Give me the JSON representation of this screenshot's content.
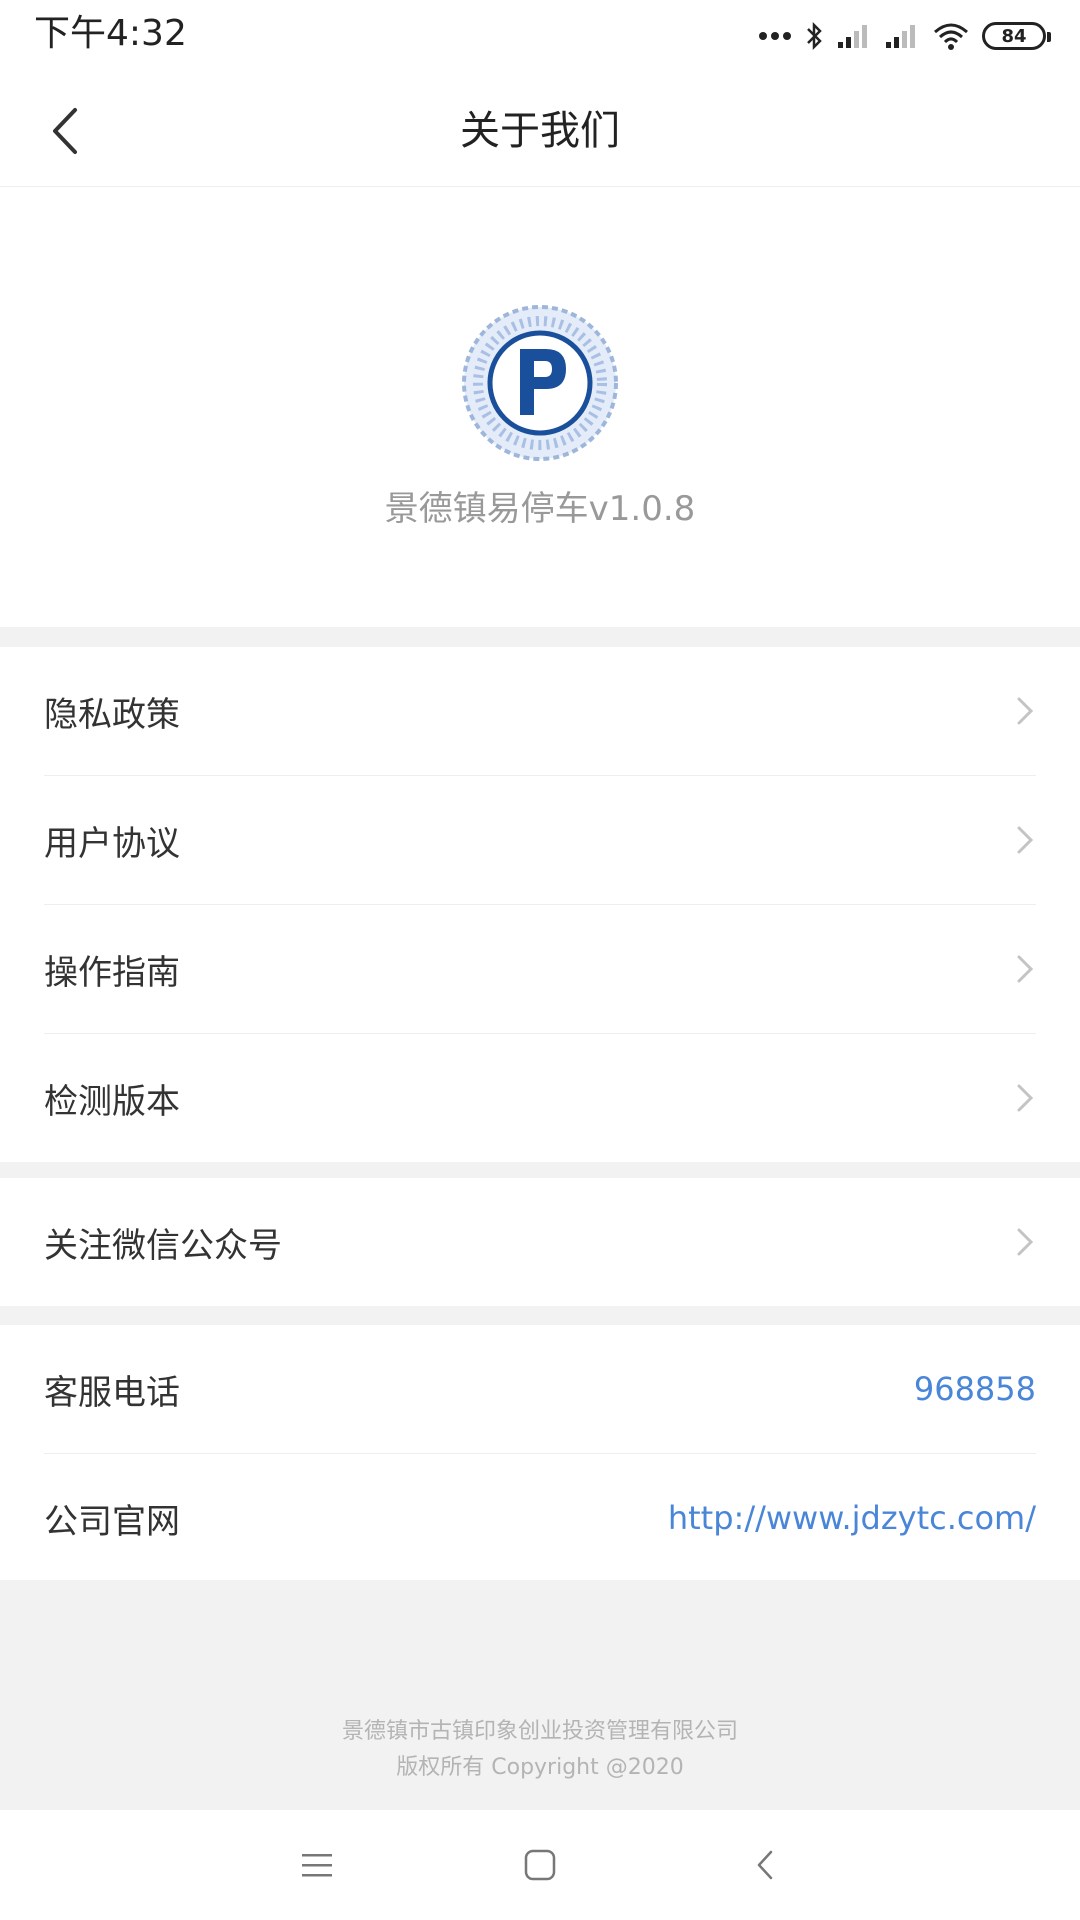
{
  "status_bar": {
    "time": "下午4:32",
    "battery": "84",
    "icons": [
      "more-dots-icon",
      "bluetooth-icon",
      "signal-icon",
      "signal-icon",
      "wifi-icon",
      "battery-icon"
    ]
  },
  "header": {
    "title": "关于我们",
    "back_icon": "back-arrow-icon"
  },
  "app": {
    "logo_icon": "parking-p-logo",
    "version_text": "景德镇易停车v1.0.8"
  },
  "menu": {
    "group1": [
      {
        "label": "隐私政策"
      },
      {
        "label": "用户协议"
      },
      {
        "label": "操作指南"
      },
      {
        "label": "检测版本"
      }
    ],
    "group2": [
      {
        "label": "关注微信公众号"
      }
    ],
    "contact": [
      {
        "label": "客服电话",
        "value": "968858"
      },
      {
        "label": "公司官网",
        "value": "http://www.jdzytc.com/"
      }
    ]
  },
  "footer": {
    "company": "景德镇市古镇印象创业投资管理有限公司",
    "copyright": "版权所有 Copyright @2020"
  },
  "system_nav": {
    "icons": [
      "menu-icon",
      "home-icon",
      "back-icon"
    ]
  },
  "colors": {
    "accent_link": "#4a86d8",
    "logo_blue": "#1a4f9c",
    "background": "#f2f2f2"
  }
}
